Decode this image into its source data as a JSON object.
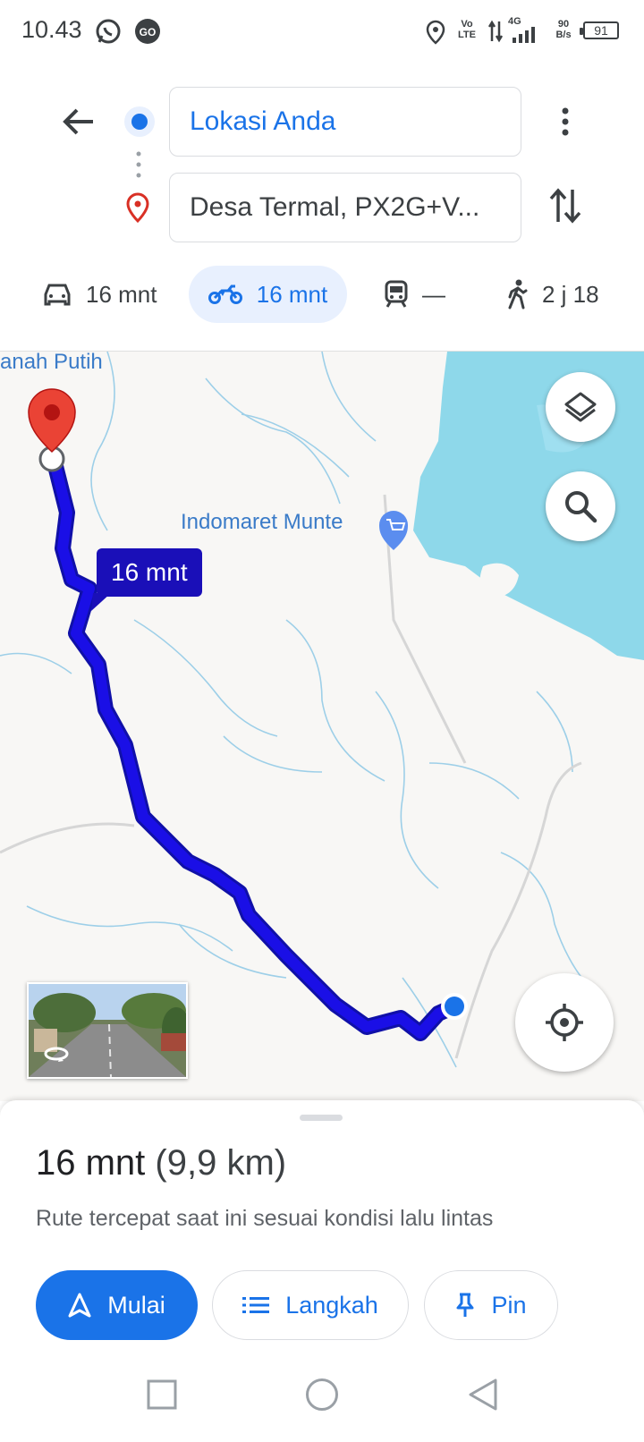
{
  "status_bar": {
    "time": "10.43",
    "network_label_top": "Vo",
    "network_label_bottom": "LTE",
    "signal_type": "4G",
    "speed_value": "90",
    "speed_unit": "B/s",
    "battery": "91"
  },
  "route_inputs": {
    "origin": "Lokasi Anda",
    "destination": "Desa Termal, PX2G+V..."
  },
  "modes": [
    {
      "icon": "car-icon",
      "label": "16 mnt"
    },
    {
      "icon": "motorcycle-icon",
      "label": "16 mnt",
      "selected": true
    },
    {
      "icon": "train-icon",
      "label": "—"
    },
    {
      "icon": "walk-icon",
      "label": "2 j 18"
    }
  ],
  "map": {
    "place_label_top": "anah Putih",
    "poi_label": "Indomaret Munte",
    "route_time_callout": "16 mnt",
    "route_color": "#1a0fe6",
    "water_color": "#8ed8ea"
  },
  "sheet": {
    "duration": "16 mnt",
    "distance": "(9,9 km)",
    "description": "Rute tercepat saat ini sesuai kondisi lalu lintas",
    "start_label": "Mulai",
    "steps_label": "Langkah",
    "pin_label": "Pin"
  }
}
